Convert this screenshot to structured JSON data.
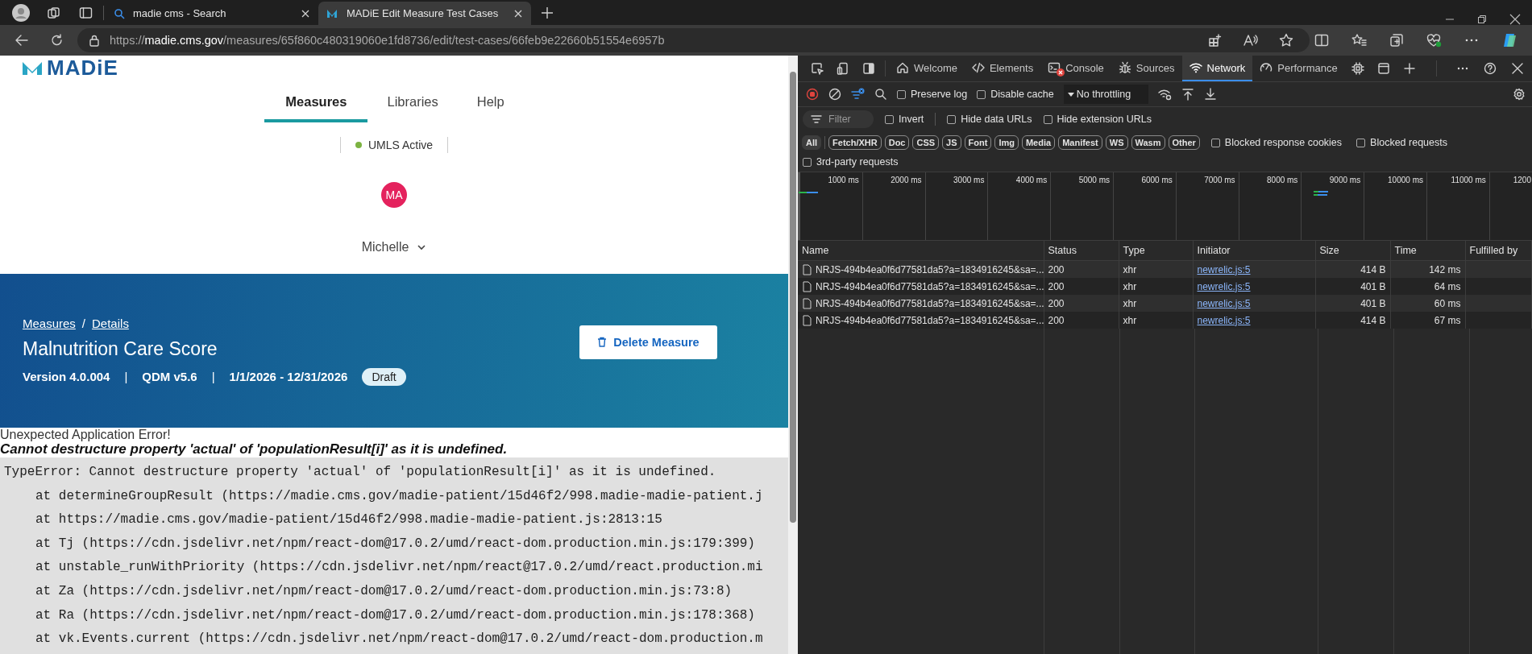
{
  "browser": {
    "tabs": [
      {
        "title": "madie cms - Search",
        "kind": "search",
        "selected": false
      },
      {
        "title": "MADiE Edit Measure Test Cases",
        "kind": "app",
        "selected": true
      }
    ],
    "address": "https://**madie.cms.gov**/measures/65f860c480319060e1fd8736/edit/test-cases/66feb9e22660b51554e6957b"
  },
  "page": {
    "logo": "MADiE",
    "nav": [
      {
        "label": "Measures",
        "selected": true
      },
      {
        "label": "Libraries",
        "selected": false
      },
      {
        "label": "Help",
        "selected": false
      }
    ],
    "umls": {
      "label": "UMLS Active",
      "active": true
    },
    "avatar": "MA",
    "user": "Michelle",
    "header": {
      "breadcrumbs": [
        {
          "kind": "link",
          "text": "Measures"
        },
        {
          "kind": "separator",
          "text": "/"
        },
        {
          "kind": "link",
          "text": "Details"
        }
      ],
      "title": "Malnutrition Care Score",
      "meta": [
        {
          "kind": "value",
          "text": "Version 4.0.004"
        },
        {
          "kind": "separator",
          "text": "|"
        },
        {
          "kind": "value",
          "text": "QDM v5.6"
        },
        {
          "kind": "separator",
          "text": "|"
        },
        {
          "kind": "value",
          "text": "1/1/2026 - 12/31/2026"
        }
      ],
      "status": "Draft",
      "delete_button": "Delete Measure"
    },
    "error": {
      "title": "Unexpected Application Error!",
      "message": "Cannot destructure property 'actual' of 'populationResult[i]' as it is undefined.",
      "stack": [
        "TypeError: Cannot destructure property 'actual' of 'populationResult[i]' as it is undefined.",
        "at determineGroupResult (https://madie.cms.gov/madie-patient/15d46f2/998.madie-madie-patient.j",
        "at https://madie.cms.gov/madie-patient/15d46f2/998.madie-madie-patient.js:2813:15",
        "at Tj (https://cdn.jsdelivr.net/npm/react-dom@17.0.2/umd/react-dom.production.min.js:179:399)",
        "at unstable_runWithPriority (https://cdn.jsdelivr.net/npm/react@17.0.2/umd/react.production.mi",
        "at Za (https://cdn.jsdelivr.net/npm/react-dom@17.0.2/umd/react-dom.production.min.js:73:8)",
        "at Ra (https://cdn.jsdelivr.net/npm/react-dom@17.0.2/umd/react-dom.production.min.js:178:368)",
        "at vk.Events.current (https://cdn.jsdelivr.net/npm/react-dom@17.0.2/umd/react-dom.production.m"
      ]
    }
  },
  "devtools": {
    "tabs": [
      {
        "label": "Welcome",
        "kind": "welcome",
        "selected": false
      },
      {
        "label": "Elements",
        "kind": "elements",
        "selected": false
      },
      {
        "label": "Console",
        "kind": "console",
        "selected": false
      },
      {
        "label": "Sources",
        "kind": "sources",
        "selected": false
      },
      {
        "label": "Network",
        "kind": "network",
        "selected": true
      },
      {
        "label": "Performance",
        "kind": "performance",
        "selected": false
      }
    ],
    "toolbar": {
      "checks": [
        {
          "label": "Preserve log",
          "checked": false
        },
        {
          "label": "Disable cache",
          "checked": false
        }
      ],
      "throttling": "No throttling"
    },
    "filter": {
      "placeholder": "Filter",
      "options": [
        {
          "label": "Invert",
          "checked": false
        },
        {
          "label": "Hide data URLs",
          "checked": false
        },
        {
          "label": "Hide extension URLs",
          "checked": false
        }
      ]
    },
    "types": [
      {
        "label": "All",
        "selected": true
      },
      {
        "label": "Fetch/XHR",
        "selected": false
      },
      {
        "label": "Doc",
        "selected": false
      },
      {
        "label": "CSS",
        "selected": false
      },
      {
        "label": "JS",
        "selected": false
      },
      {
        "label": "Font",
        "selected": false
      },
      {
        "label": "Img",
        "selected": false
      },
      {
        "label": "Media",
        "selected": false
      },
      {
        "label": "Manifest",
        "selected": false
      },
      {
        "label": "WS",
        "selected": false
      },
      {
        "label": "Wasm",
        "selected": false
      },
      {
        "label": "Other",
        "selected": false
      }
    ],
    "type_options": [
      {
        "label": "Blocked response cookies",
        "checked": false
      },
      {
        "label": "Blocked requests",
        "checked": false
      }
    ],
    "third_party": {
      "label": "3rd-party requests",
      "checked": false
    },
    "timeline": {
      "ticks": [
        "1000 ms",
        "2000 ms",
        "3000 ms",
        "4000 ms",
        "5000 ms",
        "6000 ms",
        "7000 ms",
        "8000 ms",
        "9000 ms",
        "10000 ms",
        "11000 ms",
        "1200"
      ]
    },
    "table": {
      "columns": [
        "Name",
        "Status",
        "Type",
        "Initiator",
        "Size",
        "Time",
        "Fulfilled by"
      ],
      "rows": [
        {
          "name": "NRJS-494b4ea0f6d77581da5?a=1834916245&sa=...",
          "status": "200",
          "type": "xhr",
          "initiator": "newrelic.js:5",
          "size": "414 B",
          "time": "142 ms"
        },
        {
          "name": "NRJS-494b4ea0f6d77581da5?a=1834916245&sa=...",
          "status": "200",
          "type": "xhr",
          "initiator": "newrelic.js:5",
          "size": "401 B",
          "time": "64 ms"
        },
        {
          "name": "NRJS-494b4ea0f6d77581da5?a=1834916245&sa=...",
          "status": "200",
          "type": "xhr",
          "initiator": "newrelic.js:5",
          "size": "401 B",
          "time": "60 ms"
        },
        {
          "name": "NRJS-494b4ea0f6d77581da5?a=1834916245&sa=...",
          "status": "200",
          "type": "xhr",
          "initiator": "newrelic.js:5",
          "size": "414 B",
          "time": "67 ms"
        }
      ]
    }
  }
}
